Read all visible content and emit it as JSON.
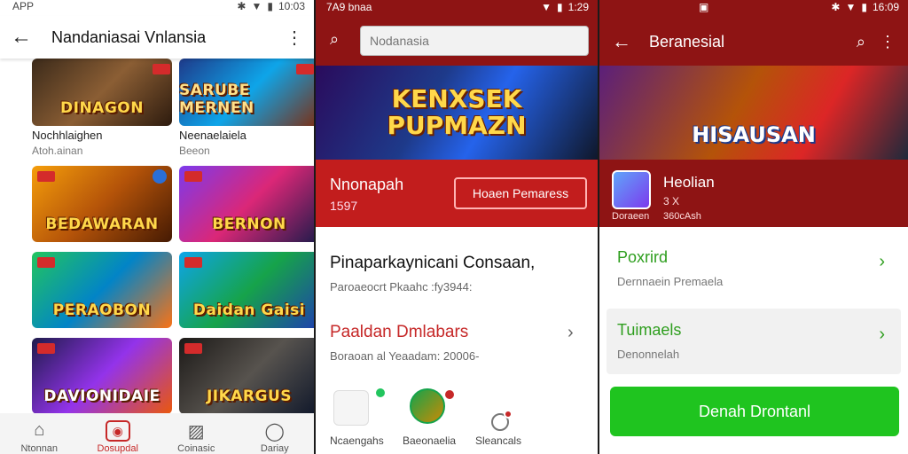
{
  "panel1": {
    "status": {
      "left": "APP",
      "time": "10:03"
    },
    "appbar": {
      "title": "Nandaniasai Vnlansia"
    },
    "tiles": [
      {
        "art": "DINAGON",
        "caption": "Nochhlaighen",
        "sub": "Atoh.ainan"
      },
      {
        "art": "SARUBE MERNEN",
        "caption": "Neenaelaiela",
        "sub": "Beeon"
      },
      {
        "art": "BEDAWARAN",
        "caption": "",
        "sub": ""
      },
      {
        "art": "BERNON",
        "caption": "",
        "sub": ""
      },
      {
        "art": "PERAOBON",
        "caption": "",
        "sub": ""
      },
      {
        "art": "Daidan Gaisi",
        "caption": "",
        "sub": ""
      },
      {
        "art": "DAVIONIDAIE",
        "caption": "",
        "sub": ""
      },
      {
        "art": "JIKARGUS",
        "caption": "",
        "sub": ""
      }
    ],
    "nav": [
      {
        "label": "Ntonnan",
        "icon": "home-icon"
      },
      {
        "label": "Dosupdal",
        "icon": "games-icon"
      },
      {
        "label": "Coinasic",
        "icon": "image-icon"
      },
      {
        "label": "Dariay",
        "icon": "profile-icon"
      }
    ]
  },
  "panel2": {
    "status": {
      "left": "7A9 bnaa",
      "time": "1:29"
    },
    "search": {
      "placeholder": "Nodanasia"
    },
    "hero": {
      "line1": "KENXSEK",
      "line2": "PUPMAZN"
    },
    "band": {
      "name": "Nnonapah",
      "number": "1597",
      "button": "Hoaen Pemaress"
    },
    "section1": {
      "title": "Pinaparkaynicani Consaan,",
      "sub": "Paroaeocrt Pkaahc :fy3944:"
    },
    "section2": {
      "title": "Paaldan Dmlabars",
      "sub": "Boraoan al Yeaadam: 20006-"
    },
    "avatars": [
      {
        "label": "Ncaengahs"
      },
      {
        "label": "Baeonaelia"
      },
      {
        "label": "Sleancals"
      }
    ]
  },
  "panel3": {
    "status": {
      "time": "16:09"
    },
    "appbar": {
      "title": "Beranesial"
    },
    "hero": {
      "text": "HISAUSAN"
    },
    "band": {
      "name": "Heolian",
      "rating": "3 X",
      "under": "Doraeen",
      "downloads": "360cAsh"
    },
    "cards": [
      {
        "title": "Poxrird",
        "sub": "Dernnaein Premaela"
      },
      {
        "title": "Tuimaels",
        "sub": "Denonnelah"
      }
    ],
    "download_button": "Denah Drontanl"
  },
  "colors": {
    "brand_red": "#8e1414",
    "accent_red": "#c21d1d",
    "green": "#1fc41f"
  }
}
